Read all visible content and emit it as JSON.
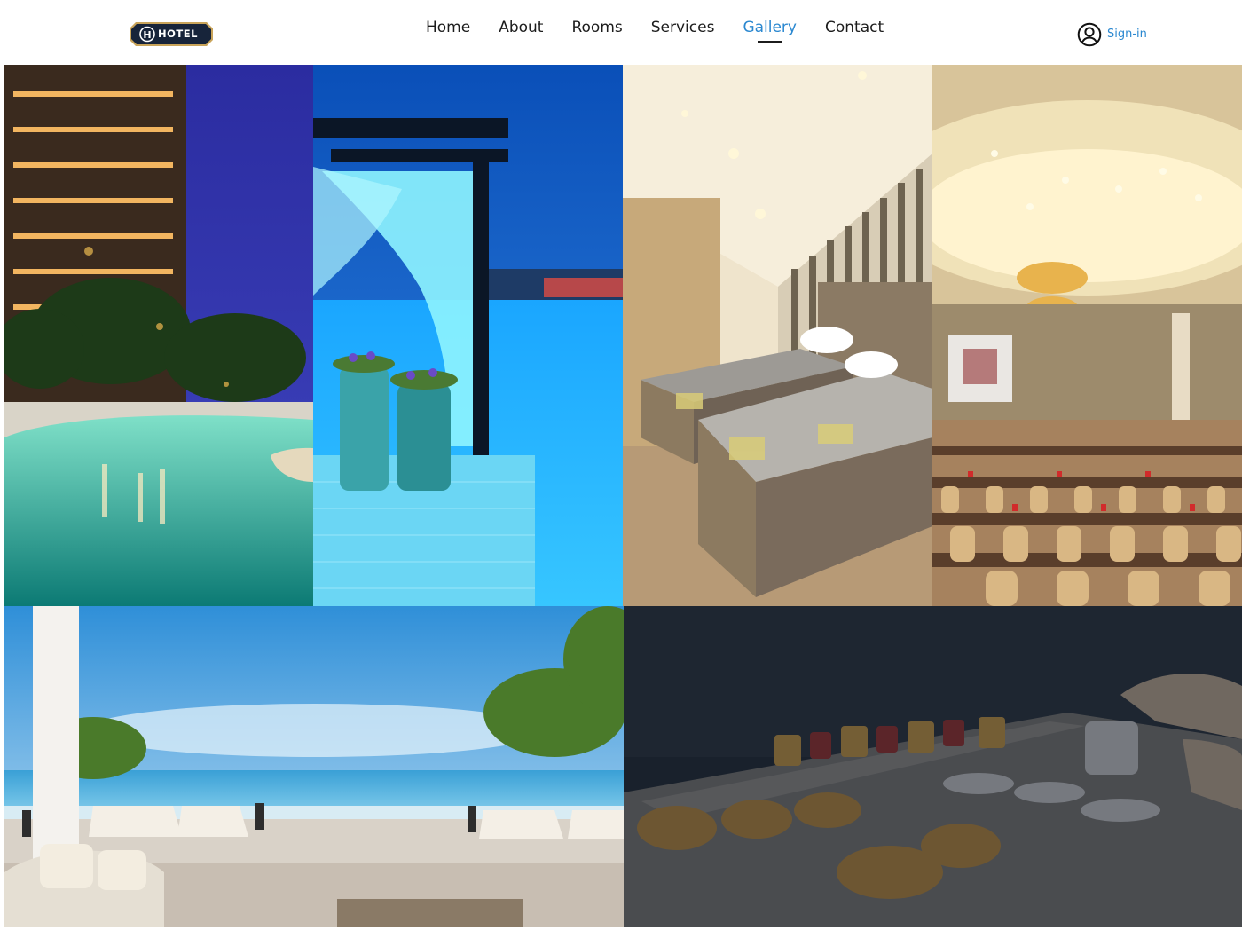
{
  "header": {
    "logo_text": "HOTEL",
    "nav": [
      {
        "label": "Home",
        "active": false
      },
      {
        "label": "About",
        "active": false
      },
      {
        "label": "Rooms",
        "active": false
      },
      {
        "label": "Services",
        "active": false
      },
      {
        "label": "Gallery",
        "active": true
      },
      {
        "label": "Contact",
        "active": false
      }
    ],
    "signin_label": "Sign-in",
    "icons": {
      "signin": "user-circle-icon"
    }
  },
  "gallery": {
    "images": [
      {
        "subject": "resort-pool-night"
      },
      {
        "subject": "poolside-cabana"
      },
      {
        "subject": "twin-bedroom"
      },
      {
        "subject": "conference-hall"
      },
      {
        "subject": "ocean-terrace"
      },
      {
        "subject": "buffet-dimmed"
      }
    ]
  },
  "colors": {
    "accent": "#2b88d0",
    "text": "#1c1c1c",
    "logo_bg": "#17243a",
    "logo_border": "#c9a45a"
  }
}
